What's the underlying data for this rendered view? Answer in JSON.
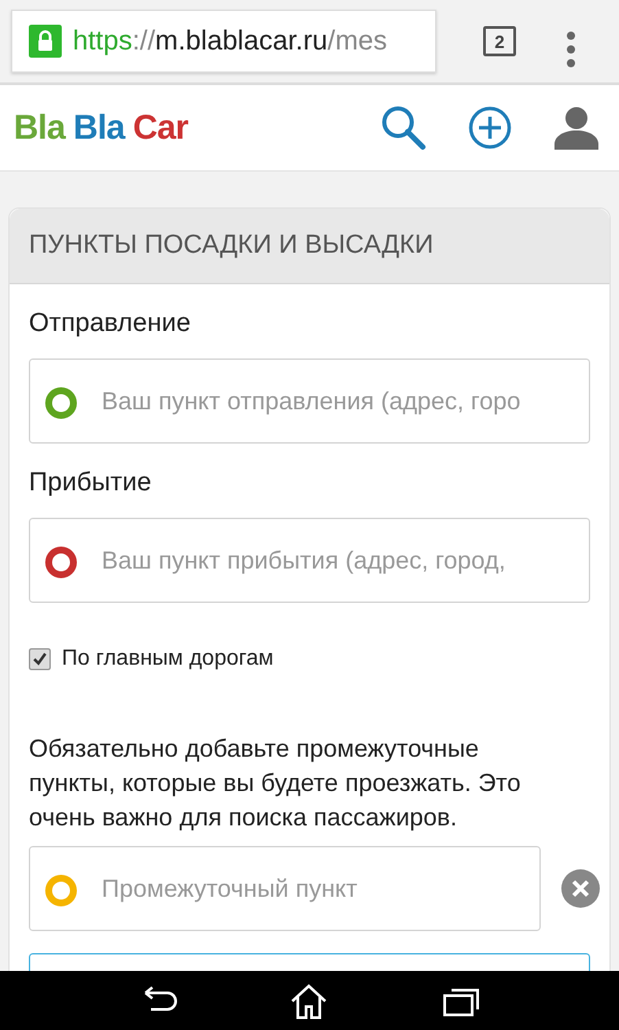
{
  "browser": {
    "url": {
      "scheme": "https",
      "separator": "://",
      "host": "m.blablacar.ru",
      "path": "/mes"
    },
    "secure": true,
    "tab_count": "2"
  },
  "header": {
    "logo": [
      {
        "text": "Bla",
        "color": "#6aa83a"
      },
      {
        "text": "Bla",
        "color": "#1f7db8"
      },
      {
        "text": "Car",
        "color": "#cc3333"
      }
    ]
  },
  "card": {
    "title": "ПУНКТЫ ПОСАДКИ И ВЫСАДКИ",
    "points": [
      {
        "label": "Отправление",
        "placeholder": "Ваш пункт отправления (адрес, горо",
        "color": "#5ea51f"
      },
      {
        "label": "Прибытие",
        "placeholder": "Ваш пункт прибытия (адрес, город,",
        "color": "#c8302f"
      }
    ],
    "main_roads": {
      "label": "По главным дорогам",
      "checked": true
    },
    "note": "Обязательно добавьте промежуточные пункты, которые вы будете проезжать. Это очень важно для поиска пассажиров.",
    "waypoints": [
      {
        "placeholder": "Промежуточный пункт",
        "color": "#f5b400"
      }
    ]
  }
}
